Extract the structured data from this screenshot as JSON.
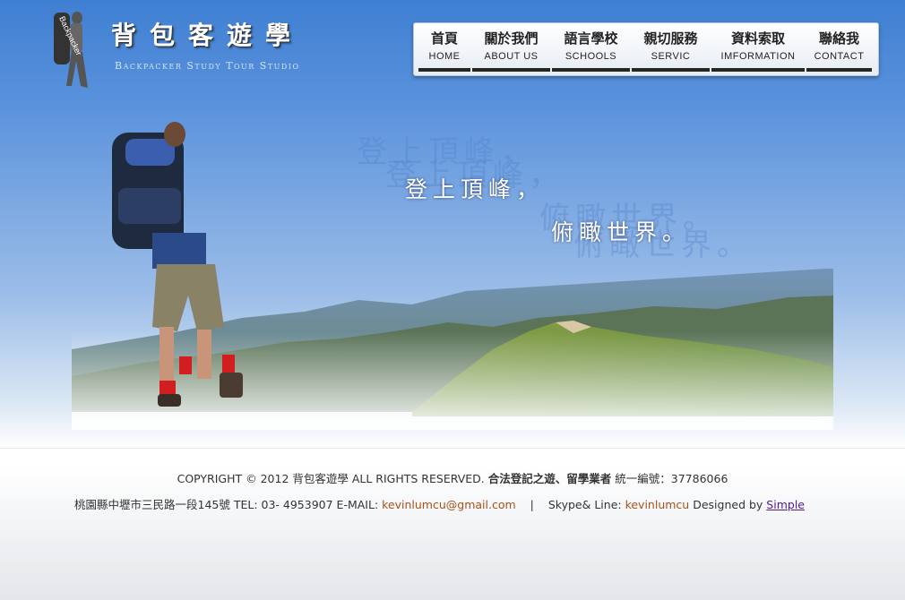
{
  "header": {
    "title": "背包客遊學",
    "subtitle": "Backpacker Study Tour Studio",
    "logo_text": "Backpacker"
  },
  "nav": [
    {
      "zh": "首頁",
      "en": "HOME"
    },
    {
      "zh": "關於我們",
      "en": "ABOUT US"
    },
    {
      "zh": "語言學校",
      "en": "SCHOOLS"
    },
    {
      "zh": "親切服務",
      "en": "SERVIC"
    },
    {
      "zh": "資料索取",
      "en": "IMFORMATION"
    },
    {
      "zh": "聯絡我",
      "en": "CONTACT"
    }
  ],
  "hero": {
    "slogan_line1": "登上頂峰，",
    "slogan_line2": "俯瞰世界。"
  },
  "footer": {
    "copyright_prefix": "COPYRIGHT © 2012 背包客遊學 ALL RIGHTS RESERVED.",
    "legal": "合法登記之遊、留學業者",
    "tax_id_label": "統一編號：",
    "tax_id": "37786066",
    "address_tel": "桃園縣中壢市三民路一段145號 TEL: 03- 4953907 E-MAIL:",
    "email": "kevinlumcu@gmail.com",
    "separator": "|",
    "skype_label": "Skype& Line:",
    "skype": "kevinlumcu",
    "designed_by_label": "Designed by",
    "designer": "Simple"
  },
  "colors": {
    "sky_top": "#3f7fd2",
    "link_orange": "#a8501a",
    "link_purple": "#551a8b",
    "nav_underline": "#262626"
  }
}
